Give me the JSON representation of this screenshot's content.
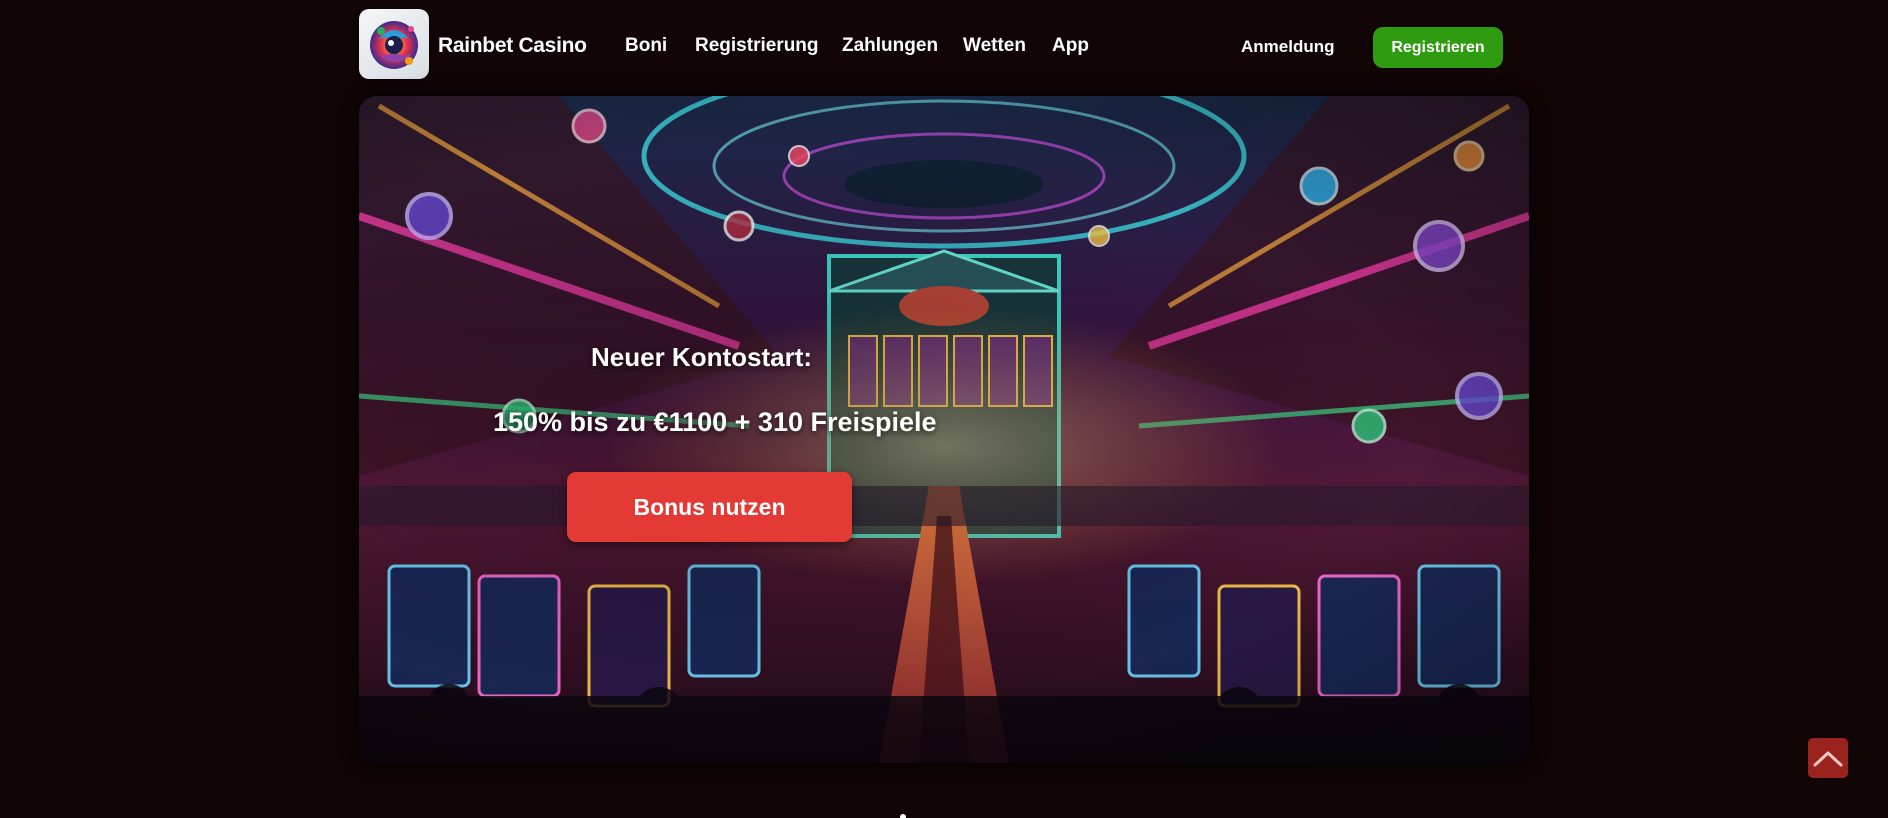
{
  "header": {
    "brand": "Rainbet Casino",
    "logo_icon": "rainbet-logo-icon",
    "nav": [
      {
        "label": "Boni"
      },
      {
        "label": "Registrierung"
      },
      {
        "label": "Zahlungen"
      },
      {
        "label": "Wetten"
      },
      {
        "label": "App"
      }
    ],
    "login_label": "Anmeldung",
    "register_label": "Registrieren"
  },
  "hero": {
    "kicker": "Neuer Kontostart:",
    "offer": "150% bis zu €1100 + 310 Freispiele",
    "cta_label": "Bonus nutzen",
    "background_image": "neon-casino-hall-illustration"
  },
  "scroll_top_icon": "chevron-up-icon",
  "colors": {
    "page_bg": "#110505",
    "register_button": "#2f9b10",
    "cta_button": "#e33a35",
    "scroll_top_button": "#9a231d",
    "text": "#ffffff"
  }
}
